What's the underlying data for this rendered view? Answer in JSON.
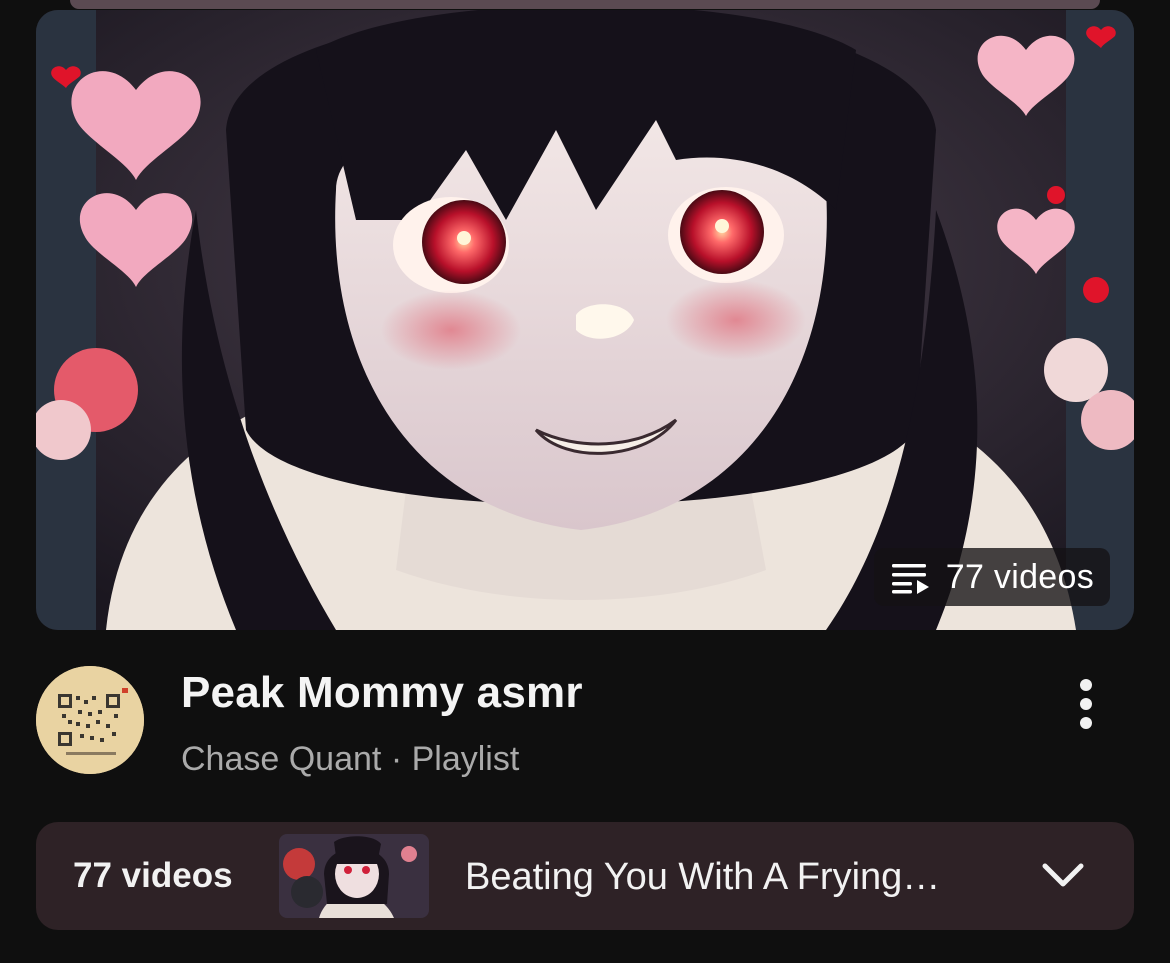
{
  "playlist": {
    "video_count_badge": "77 videos",
    "title": "Peak Mommy asmr",
    "channel": "Chase Quant",
    "separator": "·",
    "type": "Playlist"
  },
  "now_playing_bar": {
    "count": "77 videos",
    "current_title": "Beating You With A Frying…"
  },
  "icons": {
    "badge": "playlist-icon",
    "more": "more-vertical-icon",
    "expand": "chevron-down-icon"
  },
  "colors": {
    "background": "#0f0f0f",
    "bar_background": "#2e2226",
    "subtitle": "#aaaaaa",
    "text": "#f1f1f1"
  }
}
